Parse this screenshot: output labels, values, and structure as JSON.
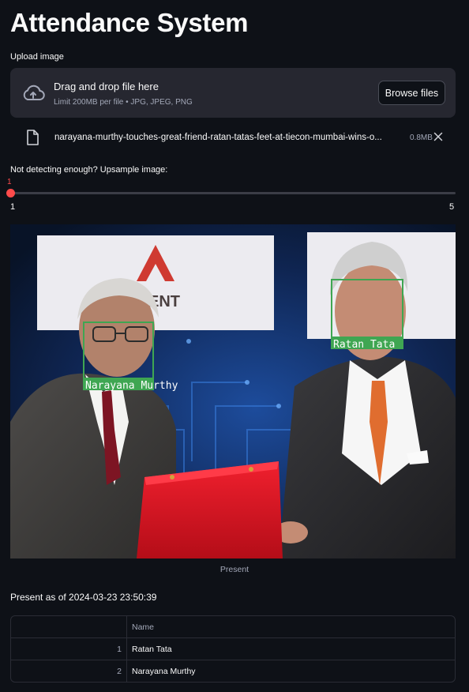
{
  "page": {
    "title": "Attendance System"
  },
  "uploader": {
    "label": "Upload image",
    "drop_text": "Drag and drop file here",
    "limit_text": "Limit 200MB per file • JPG, JPEG, PNG",
    "browse_label": "Browse files",
    "file": {
      "name": "narayana-murthy-touches-great-friend-ratan-tatas-feet-at-tiecon-mumbai-wins-o...",
      "size": "0.8MB"
    }
  },
  "slider": {
    "label": "Not detecting enough? Upsample image:",
    "value": 1,
    "value_text": "1",
    "min": "1",
    "max": "5"
  },
  "image": {
    "caption": "Present",
    "faces": [
      {
        "name": "Narayana Murthy"
      },
      {
        "name": "Ratan Tata"
      }
    ],
    "backdrop_text": "ENT"
  },
  "attendance": {
    "heading": "Present as of 2024-03-23 23:50:39",
    "columns": [
      "",
      "Name"
    ],
    "rows": [
      {
        "index": "1",
        "name": "Ratan Tata"
      },
      {
        "index": "2",
        "name": "Narayana Murthy"
      }
    ]
  },
  "colors": {
    "background": "#0e1117",
    "panel": "#262730",
    "accent": "#ff4b4b",
    "box": "#3fa652"
  }
}
